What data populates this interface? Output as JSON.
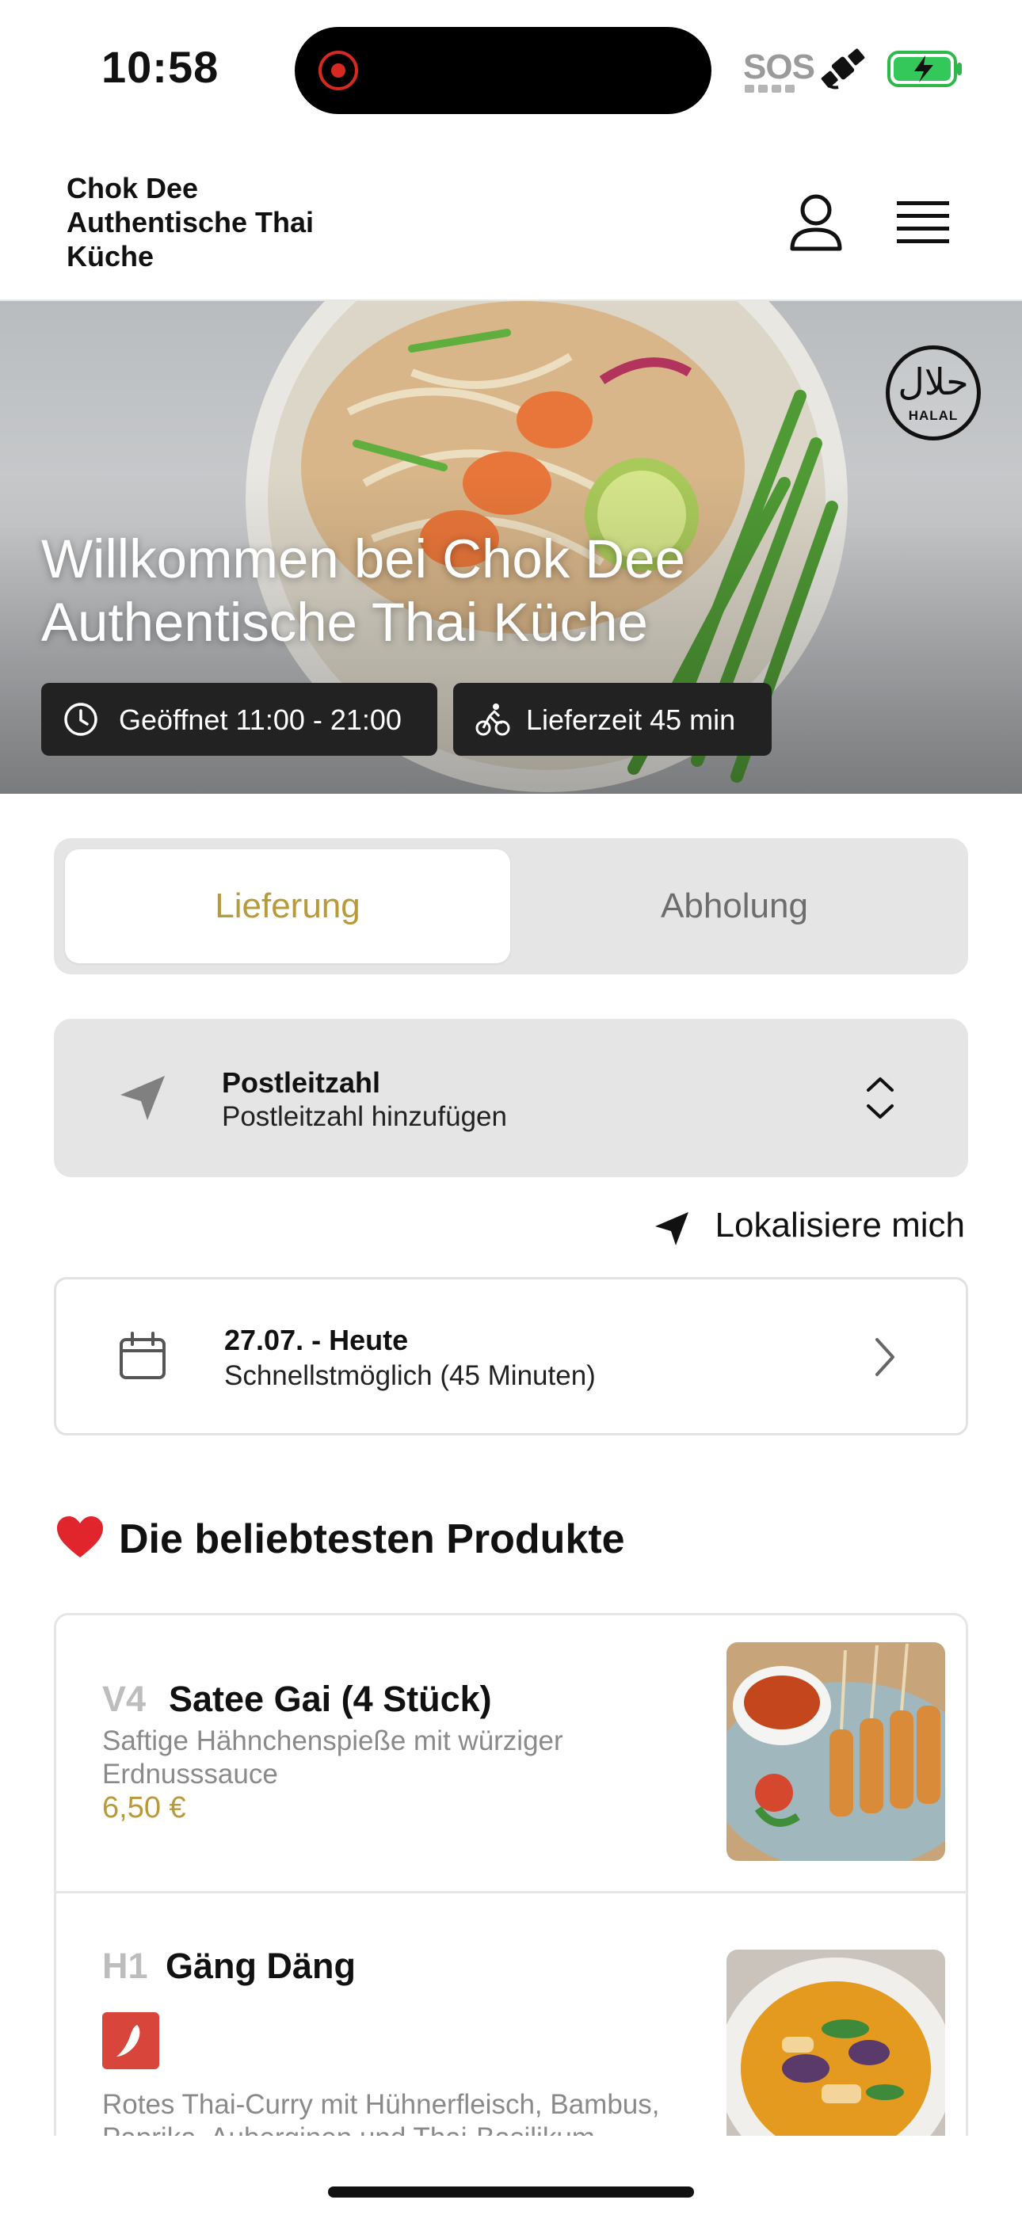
{
  "status_bar": {
    "time": "10:58",
    "sos": "SOS"
  },
  "header": {
    "brand": "Chok Dee Authentische Thai Küche"
  },
  "hero": {
    "title": "Willkommen bei Chok Dee Authentische Thai Küche",
    "badge_arabic": "حلال",
    "badge_text": "HALAL",
    "opening_hours": "Geöffnet 11:00 - 21:00",
    "delivery_time": "Lieferzeit 45 min"
  },
  "mode": {
    "delivery_label": "Lieferung",
    "pickup_label": "Abholung",
    "selected": "Lieferung"
  },
  "postcode": {
    "label": "Postleitzahl",
    "placeholder": "Postleitzahl hinzufügen"
  },
  "locate": {
    "label": "Lokalisiere mich"
  },
  "date": {
    "title": "27.07. - Heute",
    "subtitle": "Schnellstmöglich (45 Minuten)"
  },
  "popular": {
    "title": "Die beliebtesten Produkte",
    "products": [
      {
        "code": "V4",
        "name": "Satee Gai (4 Stück)",
        "description": "Saftige Hähnchenspieße mit würziger Erdnusssauce",
        "price": "6,50 €"
      },
      {
        "code": "H1",
        "name": "Gäng Däng",
        "description": "Rotes Thai-Curry mit Hühnerfleisch, Bambus, Paprika, Auberginen und Thai-Basilikum"
      }
    ]
  },
  "colors": {
    "accent": "#b99a3a",
    "chip_bg": "#222222",
    "spicy": "#d8453a",
    "panel_bg": "#e5e5e5"
  }
}
